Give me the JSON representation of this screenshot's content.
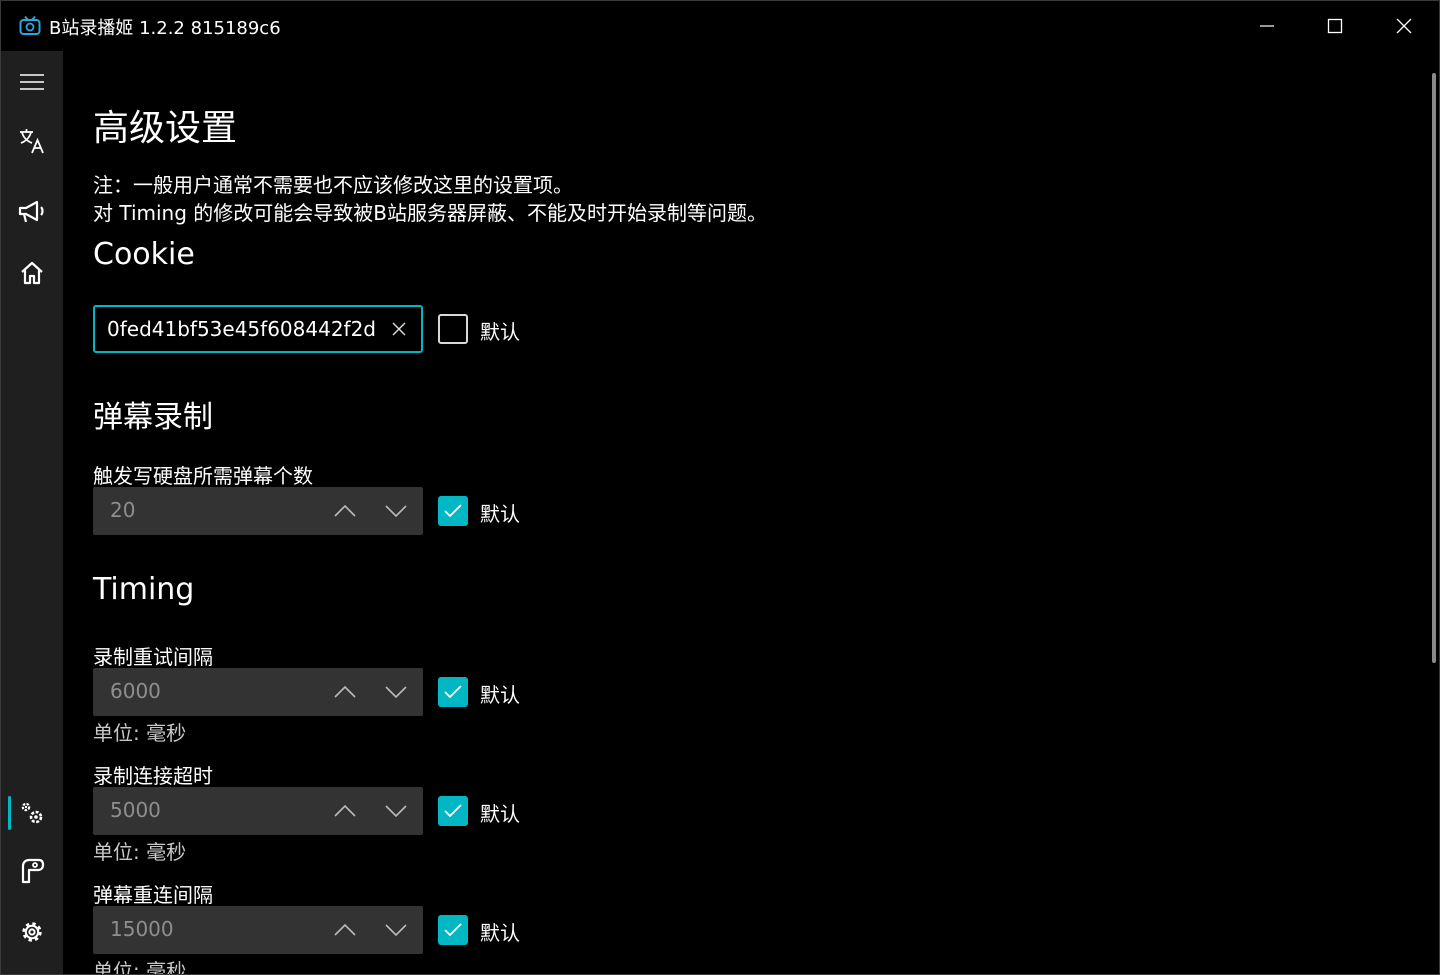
{
  "window": {
    "title": "B站录播姬 1.2.2 815189c6"
  },
  "nav": {
    "items": [
      {
        "icon": "hamburger-menu-icon"
      },
      {
        "icon": "language-translate-icon"
      },
      {
        "icon": "megaphone-icon"
      },
      {
        "icon": "home-icon"
      },
      {
        "icon": "advanced-settings-icon"
      },
      {
        "icon": "log-icon"
      },
      {
        "icon": "gear-icon"
      }
    ],
    "active": "advanced-settings-icon"
  },
  "page": {
    "title": "高级设置",
    "note_line1": "注：一般用户通常不需要也不应该修改这里的设置项。",
    "note_line2": "对 Timing 的修改可能会导致被B站服务器屏蔽、不能及时开始录制等问题。"
  },
  "cookie": {
    "section_title": "Cookie",
    "value": "0fed41bf53e45f608442f2d",
    "default_label": "默认",
    "default_checked": false
  },
  "danmaku": {
    "section_title": "弹幕录制",
    "trigger_label": "触发写硬盘所需弹幕个数",
    "trigger_value": "20",
    "default_label": "默认",
    "default_checked": true
  },
  "timing": {
    "section_title": "Timing",
    "retry": {
      "label": "录制重试间隔",
      "value": "6000",
      "unit": "单位: 毫秒",
      "default_label": "默认",
      "default_checked": true
    },
    "connect_timeout": {
      "label": "录制连接超时",
      "value": "5000",
      "unit": "单位: 毫秒",
      "default_label": "默认",
      "default_checked": true
    },
    "danmaku_reconnect": {
      "label": "弹幕重连间隔",
      "value": "15000",
      "unit": "单位: 毫秒",
      "default_label": "默认",
      "default_checked": true
    }
  },
  "colors": {
    "accent": "#00b7c3",
    "nav_bg": "#1f1f1f",
    "numbox_bg": "#333333"
  }
}
